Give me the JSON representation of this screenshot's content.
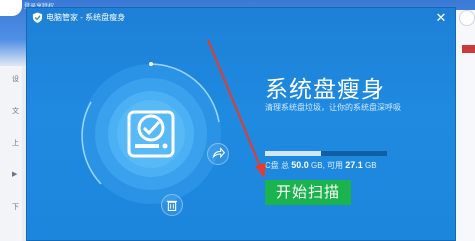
{
  "background": {
    "link_text": "登录享特权",
    "side_items": [
      "设",
      "文",
      "上",
      "▶",
      "下"
    ]
  },
  "dialog": {
    "title": "电脑管家 - 系统盘瘦身",
    "close_label": "✕",
    "headline": "系统盘瘦身",
    "subtitle": "清理系统盘垃圾，让你的系统盘深呼吸",
    "disk": {
      "drive_label": "C盘",
      "total_label": "总",
      "total_value": "50.0",
      "available_label": "可用",
      "available_value": "27.1",
      "unit": "GB",
      "used_fraction": 0.458
    },
    "start_button": "开始扫描",
    "icons": {
      "title": "shield-icon",
      "share": "share-icon",
      "trash": "trash-icon",
      "drive": "drive-check-icon"
    },
    "colors": {
      "dialog_bg": "#1f8ae0",
      "start_button": "#1ab34d",
      "arrow": "#e43b2c"
    }
  }
}
